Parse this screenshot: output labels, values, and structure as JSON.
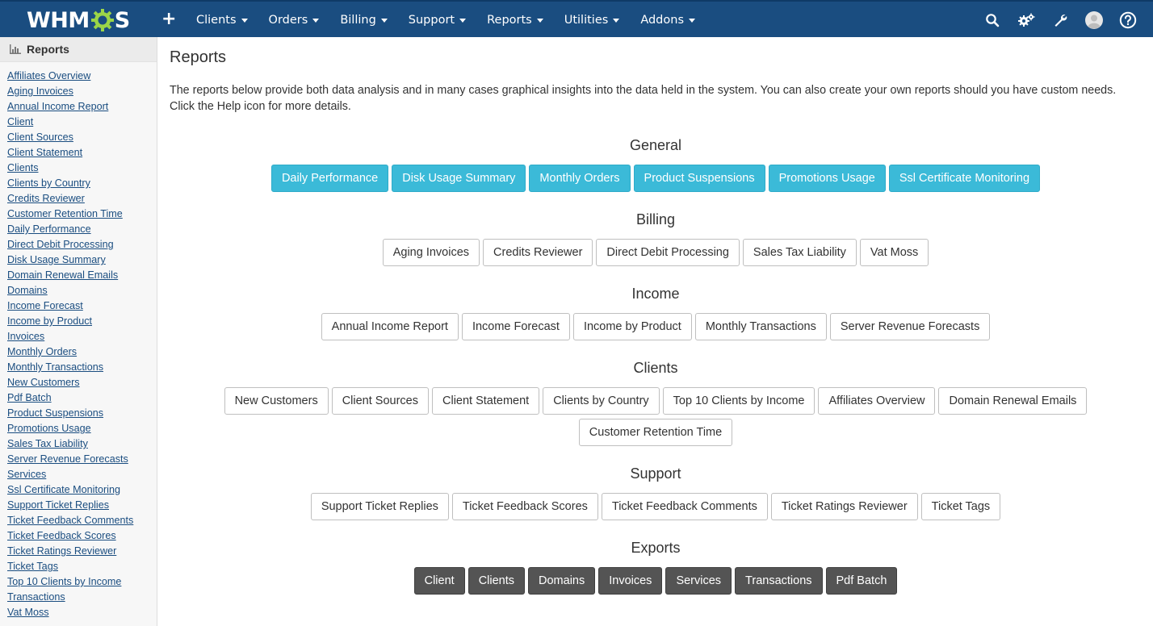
{
  "app": {
    "logo_text_left": "WHM",
    "logo_text_right": "S"
  },
  "nav": {
    "add_label": "+",
    "items": [
      {
        "label": "Clients"
      },
      {
        "label": "Orders"
      },
      {
        "label": "Billing"
      },
      {
        "label": "Support"
      },
      {
        "label": "Reports"
      },
      {
        "label": "Utilities"
      },
      {
        "label": "Addons"
      }
    ],
    "right_icons": [
      "search-icon",
      "cogs-icon",
      "wrench-icon",
      "user-avatar-icon",
      "help-icon"
    ]
  },
  "sidebar": {
    "title": "Reports",
    "items": [
      "Affiliates Overview",
      "Aging Invoices",
      "Annual Income Report",
      "Client",
      "Client Sources",
      "Client Statement",
      "Clients",
      "Clients by Country",
      "Credits Reviewer",
      "Customer Retention Time",
      "Daily Performance",
      "Direct Debit Processing",
      "Disk Usage Summary",
      "Domain Renewal Emails",
      "Domains",
      "Income Forecast",
      "Income by Product",
      "Invoices",
      "Monthly Orders",
      "Monthly Transactions",
      "New Customers",
      "Pdf Batch",
      "Product Suspensions",
      "Promotions Usage",
      "Sales Tax Liability",
      "Server Revenue Forecasts",
      "Services",
      "Ssl Certificate Monitoring",
      "Support Ticket Replies",
      "Ticket Feedback Comments",
      "Ticket Feedback Scores",
      "Ticket Ratings Reviewer",
      "Ticket Tags",
      "Top 10 Clients by Income",
      "Transactions",
      "Vat Moss"
    ]
  },
  "main": {
    "title": "Reports",
    "intro": "The reports below provide both data analysis and in many cases graphical insights into the data held in the system. You can also create your own reports should you have custom needs. Click the Help icon for more details.",
    "sections": [
      {
        "heading": "General",
        "style": "info",
        "buttons": [
          "Daily Performance",
          "Disk Usage Summary",
          "Monthly Orders",
          "Product Suspensions",
          "Promotions Usage",
          "Ssl Certificate Monitoring"
        ]
      },
      {
        "heading": "Billing",
        "style": "default",
        "buttons": [
          "Aging Invoices",
          "Credits Reviewer",
          "Direct Debit Processing",
          "Sales Tax Liability",
          "Vat Moss"
        ]
      },
      {
        "heading": "Income",
        "style": "default",
        "buttons": [
          "Annual Income Report",
          "Income Forecast",
          "Income by Product",
          "Monthly Transactions",
          "Server Revenue Forecasts"
        ]
      },
      {
        "heading": "Clients",
        "style": "default",
        "buttons": [
          "New Customers",
          "Client Sources",
          "Client Statement",
          "Clients by Country",
          "Top 10 Clients by Income",
          "Affiliates Overview",
          "Domain Renewal Emails",
          "Customer Retention Time"
        ]
      },
      {
        "heading": "Support",
        "style": "default",
        "buttons": [
          "Support Ticket Replies",
          "Ticket Feedback Scores",
          "Ticket Feedback Comments",
          "Ticket Ratings Reviewer",
          "Ticket Tags"
        ]
      },
      {
        "heading": "Exports",
        "style": "dark",
        "buttons": [
          "Client",
          "Clients",
          "Domains",
          "Invoices",
          "Services",
          "Transactions",
          "Pdf Batch"
        ]
      }
    ]
  },
  "colors": {
    "topbar": "#1a4d80",
    "info_button": "#3bbad8",
    "dark_button": "#545454",
    "link": "#1a4d80",
    "logo_gear": "#9bd548"
  }
}
